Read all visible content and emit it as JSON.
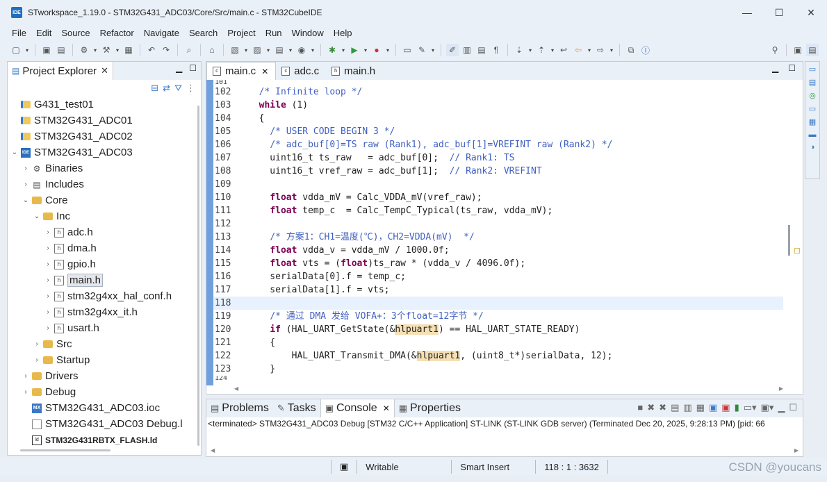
{
  "window": {
    "title": "STworkspace_1.19.0 - STM32G431_ADC03/Core/Src/main.c - STM32CubeIDE",
    "app_icon": "IDE"
  },
  "menu": [
    "File",
    "Edit",
    "Source",
    "Refactor",
    "Navigate",
    "Search",
    "Project",
    "Run",
    "Window",
    "Help"
  ],
  "explorer": {
    "title": "Project Explorer",
    "items": [
      {
        "label": "G431_test01",
        "icon": "project-icon",
        "depth": 0,
        "arrow": ""
      },
      {
        "label": "STM32G431_ADC01",
        "icon": "project-icon",
        "depth": 0,
        "arrow": ""
      },
      {
        "label": "STM32G431_ADC02",
        "icon": "project-icon",
        "depth": 0,
        "arrow": ""
      },
      {
        "label": "STM32G431_ADC03",
        "icon": "ide-project-icon",
        "depth": 0,
        "arrow": "v"
      },
      {
        "label": "Binaries",
        "icon": "binaries-icon",
        "depth": 1,
        "arrow": ">"
      },
      {
        "label": "Includes",
        "icon": "includes-icon",
        "depth": 1,
        "arrow": ">"
      },
      {
        "label": "Core",
        "icon": "folder-icon",
        "depth": 1,
        "arrow": "v"
      },
      {
        "label": "Inc",
        "icon": "folder-icon",
        "depth": 2,
        "arrow": "v"
      },
      {
        "label": "adc.h",
        "icon": "header-file-icon",
        "depth": 3,
        "arrow": ">"
      },
      {
        "label": "dma.h",
        "icon": "header-file-icon",
        "depth": 3,
        "arrow": ">"
      },
      {
        "label": "gpio.h",
        "icon": "header-file-icon",
        "depth": 3,
        "arrow": ">"
      },
      {
        "label": "main.h",
        "icon": "header-file-icon",
        "depth": 3,
        "arrow": ">",
        "selected": true
      },
      {
        "label": "stm32g4xx_hal_conf.h",
        "icon": "header-file-icon",
        "depth": 3,
        "arrow": ">"
      },
      {
        "label": "stm32g4xx_it.h",
        "icon": "header-file-icon",
        "depth": 3,
        "arrow": ">"
      },
      {
        "label": "usart.h",
        "icon": "header-file-icon",
        "depth": 3,
        "arrow": ">"
      },
      {
        "label": "Src",
        "icon": "folder-icon",
        "depth": 2,
        "arrow": ">"
      },
      {
        "label": "Startup",
        "icon": "folder-icon",
        "depth": 2,
        "arrow": ">"
      },
      {
        "label": "Drivers",
        "icon": "folder-icon",
        "depth": 1,
        "arrow": ">"
      },
      {
        "label": "Debug",
        "icon": "folder-icon",
        "depth": 1,
        "arrow": ">"
      },
      {
        "label": "STM32G431_ADC03.ioc",
        "icon": "mx-file-icon",
        "depth": 1,
        "arrow": ""
      },
      {
        "label": "STM32G431_ADC03 Debug.l",
        "icon": "text-file-icon",
        "depth": 1,
        "arrow": ""
      },
      {
        "label": "STM32G431RBTX_FLASH.ld",
        "icon": "ld-file-icon",
        "depth": 1,
        "arrow": "",
        "bold": true
      }
    ]
  },
  "editor": {
    "tabs": [
      {
        "label": "main.c",
        "icon": "c-file-icon",
        "active": true
      },
      {
        "label": "adc.c",
        "icon": "c-file-icon",
        "active": false
      },
      {
        "label": "main.h",
        "icon": "header-file-icon",
        "active": false
      }
    ],
    "top_partial_line": "101",
    "bottom_partial_line": "124",
    "lines": [
      {
        "n": "102",
        "code": [
          [
            "  ",
            ""
          ],
          [
            "/* Infinite loop */",
            "cm"
          ]
        ]
      },
      {
        "n": "103",
        "code": [
          [
            "  ",
            ""
          ],
          [
            "while",
            "kw"
          ],
          [
            " (1)",
            ""
          ]
        ]
      },
      {
        "n": "104",
        "code": [
          [
            "  {",
            ""
          ]
        ]
      },
      {
        "n": "105",
        "code": [
          [
            "    ",
            ""
          ],
          [
            "/* USER CODE BEGIN 3 */",
            "cm"
          ]
        ]
      },
      {
        "n": "106",
        "code": [
          [
            "    ",
            ""
          ],
          [
            "/* adc_buf[0]=TS raw (Rank1), adc_buf[1]=VREFINT raw (Rank2) */",
            "cm"
          ]
        ]
      },
      {
        "n": "107",
        "code": [
          [
            "    uint16_t ts_raw   = adc_buf[0];  ",
            ""
          ],
          [
            "// Rank1: TS",
            "cm"
          ]
        ]
      },
      {
        "n": "108",
        "code": [
          [
            "    uint16_t vref_raw = adc_buf[1];  ",
            ""
          ],
          [
            "// Rank2: VREFINT",
            "cm"
          ]
        ]
      },
      {
        "n": "109",
        "code": [
          [
            "",
            ""
          ]
        ]
      },
      {
        "n": "110",
        "code": [
          [
            "    ",
            ""
          ],
          [
            "float",
            "kw"
          ],
          [
            " vdda_mV = Calc_VDDA_mV(vref_raw);",
            ""
          ]
        ]
      },
      {
        "n": "111",
        "code": [
          [
            "    ",
            ""
          ],
          [
            "float",
            "kw"
          ],
          [
            " temp_c  = Calc_TempC_Typical(ts_raw, vdda_mV);",
            ""
          ]
        ]
      },
      {
        "n": "112",
        "code": [
          [
            "",
            ""
          ]
        ]
      },
      {
        "n": "113",
        "code": [
          [
            "    ",
            ""
          ],
          [
            "/* 方案1：CH1=温度(℃)，CH2=VDDA(mV)  */",
            "cm"
          ]
        ]
      },
      {
        "n": "114",
        "code": [
          [
            "    ",
            ""
          ],
          [
            "float",
            "kw"
          ],
          [
            " vdda_v = vdda_mV / 1000.0f;",
            ""
          ]
        ]
      },
      {
        "n": "115",
        "code": [
          [
            "    ",
            ""
          ],
          [
            "float",
            "kw"
          ],
          [
            " vts = (",
            ""
          ],
          [
            "float",
            "kw"
          ],
          [
            ")ts_raw * (vdda_v / 4096.0f);",
            ""
          ]
        ]
      },
      {
        "n": "116",
        "code": [
          [
            "    serialData[0].f = temp_c;",
            ""
          ]
        ]
      },
      {
        "n": "117",
        "code": [
          [
            "    serialData[1].f = vts;",
            ""
          ]
        ]
      },
      {
        "n": "118",
        "code": [
          [
            "",
            ""
          ]
        ],
        "current": true
      },
      {
        "n": "119",
        "code": [
          [
            "    ",
            ""
          ],
          [
            "/* 通过 DMA 发给 VOFA+：3个float=12字节 */",
            "cm"
          ]
        ]
      },
      {
        "n": "120",
        "code": [
          [
            "    ",
            ""
          ],
          [
            "if",
            "kw"
          ],
          [
            " (HAL_UART_GetState(&",
            ""
          ],
          [
            "hlpuart1",
            "hl"
          ],
          [
            ") == HAL_UART_STATE_READY)",
            ""
          ]
        ]
      },
      {
        "n": "121",
        "code": [
          [
            "    {",
            ""
          ]
        ]
      },
      {
        "n": "122",
        "code": [
          [
            "        HAL_UART_Transmit_DMA(&",
            ""
          ],
          [
            "hlpuart1",
            "hl"
          ],
          [
            ", (uint8_t*)serialData, 12);",
            ""
          ]
        ]
      },
      {
        "n": "123",
        "code": [
          [
            "    }",
            ""
          ]
        ]
      }
    ]
  },
  "bottom_panel": {
    "tabs": [
      {
        "label": "Problems",
        "icon": "problems-icon"
      },
      {
        "label": "Tasks",
        "icon": "tasks-icon"
      },
      {
        "label": "Console",
        "icon": "console-icon",
        "active": true
      },
      {
        "label": "Properties",
        "icon": "properties-icon"
      }
    ],
    "console_line": "<terminated> STM32G431_ADC03 Debug [STM32 C/C++ Application] ST-LINK (ST-LINK GDB server) (Terminated Dec 20, 2025, 9:28:13 PM) [pid: 66"
  },
  "status": {
    "writable": "Writable",
    "insert_mode": "Smart Insert",
    "position": "118 : 1 : 3632"
  },
  "watermark": "CSDN @youcans"
}
